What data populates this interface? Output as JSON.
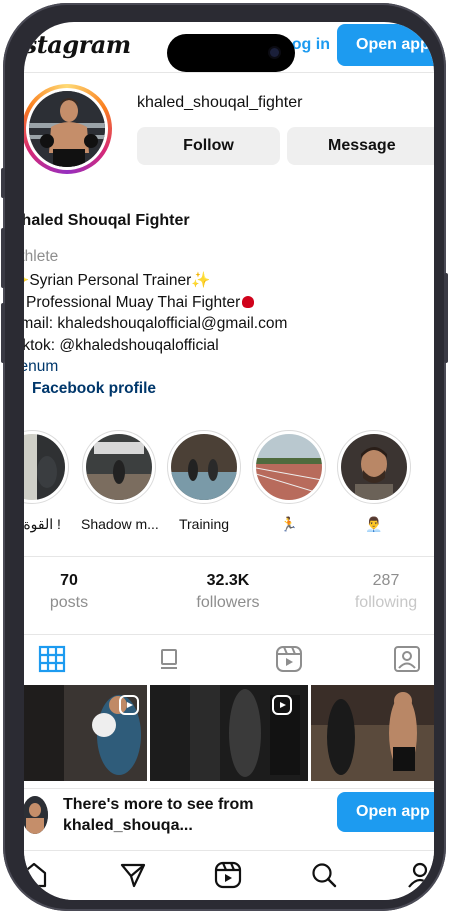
{
  "app": {
    "logo": "Instagram",
    "login_label": "Log in",
    "open_app_label": "Open app"
  },
  "profile": {
    "username": "khaled_shouqal_fighter",
    "follow_label": "Follow",
    "message_label": "Message",
    "display_name": "Khaled Shouqal Fighter",
    "category": "Athlete",
    "bio_lines": [
      "Syrian Personal Trainer",
      "Professional Muay Thai Fighter",
      "Email: khaledshouqalofficial@gmail.com",
      "Tiktok: @khaledshouqalofficial"
    ],
    "link_text": "Venum",
    "facebook_label": "Facebook profile"
  },
  "highlights": [
    {
      "caption": "القوة لله !"
    },
    {
      "caption": "Shadow m..."
    },
    {
      "caption": "Training"
    },
    {
      "caption": "🏃"
    },
    {
      "caption": "👨‍💼"
    }
  ],
  "stats": {
    "posts_value": "70",
    "posts_label": "posts",
    "followers_value": "32.3K",
    "followers_label": "followers",
    "following_value": "287",
    "following_label": "following"
  },
  "banner": {
    "line1": "There's more to see from",
    "line2": "khaled_shouqa...",
    "button": "Open app"
  },
  "colors": {
    "accent": "#1d9bf0",
    "link": "#00376b",
    "muted": "#8e8e8e"
  },
  "icons": [
    "grid-icon",
    "feed-icon",
    "reels-icon",
    "tagged-icon",
    "home-icon",
    "direct-icon",
    "reels-nav-icon",
    "search-icon",
    "profile-icon"
  ]
}
